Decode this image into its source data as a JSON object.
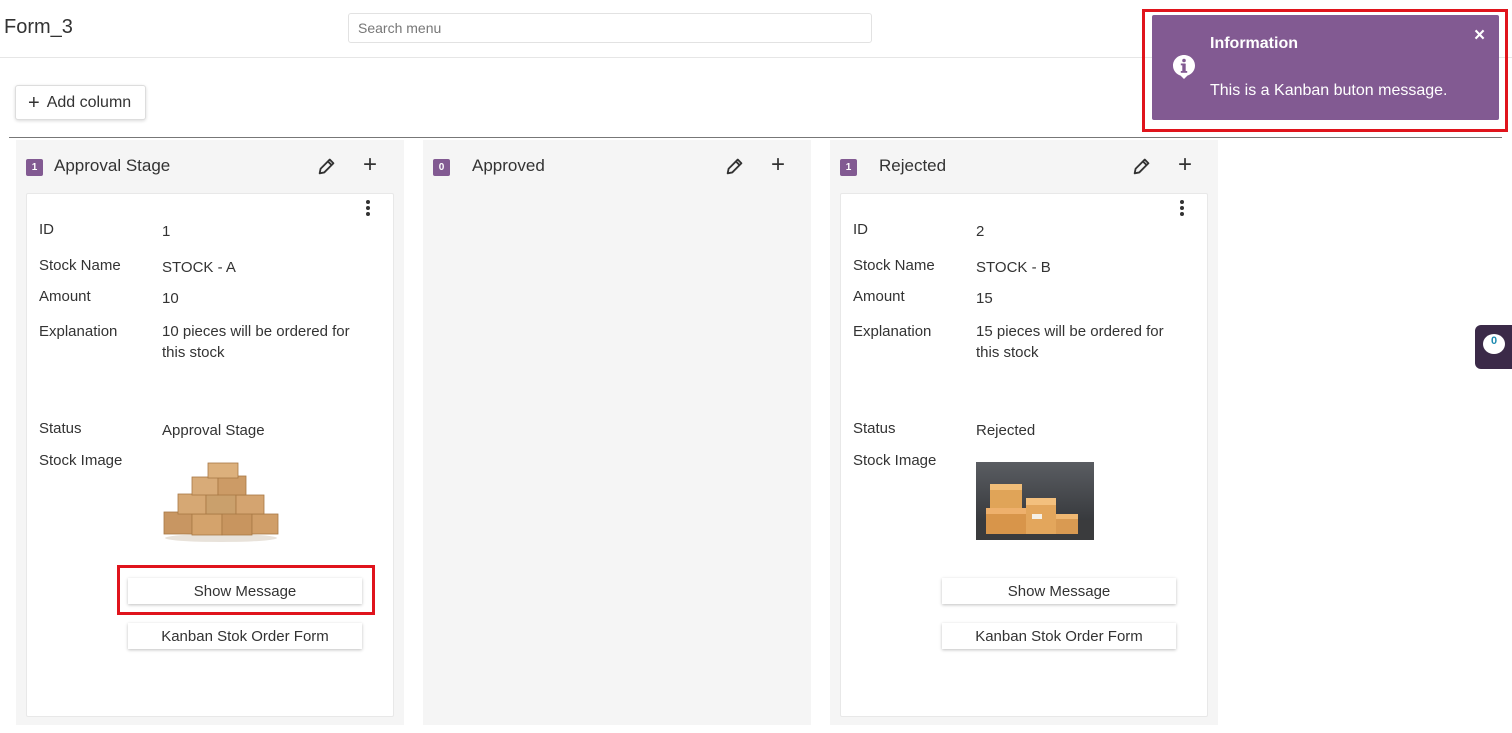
{
  "header": {
    "title": "Form_3",
    "search_placeholder": "Search menu"
  },
  "toolbar": {
    "add_column_label": "Add column"
  },
  "colors": {
    "accent": "#825a92",
    "highlight": "#e0141c"
  },
  "columns": [
    {
      "count": "1",
      "title": "Approval Stage",
      "cards": [
        {
          "fields": [
            {
              "label": "ID",
              "value": "1"
            },
            {
              "label": "Stock Name",
              "value": "STOCK - A"
            },
            {
              "label": "Amount",
              "value": "10"
            },
            {
              "label": "Explanation",
              "value": "10 pieces will be ordered for this stock"
            },
            {
              "label": "Status",
              "value": "Approval Stage"
            },
            {
              "label": "Stock Image",
              "value": ""
            }
          ],
          "buttons": [
            "Show Message",
            "Kanban Stok Order Form"
          ]
        }
      ]
    },
    {
      "count": "0",
      "title": "Approved",
      "cards": []
    },
    {
      "count": "1",
      "title": "Rejected",
      "cards": [
        {
          "fields": [
            {
              "label": "ID",
              "value": "2"
            },
            {
              "label": "Stock Name",
              "value": "STOCK - B"
            },
            {
              "label": "Amount",
              "value": "15"
            },
            {
              "label": "Explanation",
              "value": "15 pieces will be ordered for this stock"
            },
            {
              "label": "Status",
              "value": "Rejected"
            },
            {
              "label": "Stock Image",
              "value": ""
            }
          ],
          "buttons": [
            "Show Message",
            "Kanban Stok Order Form"
          ]
        }
      ]
    }
  ],
  "toast": {
    "title": "Information",
    "message": "This is a Kanban buton message.",
    "icon": "info-icon",
    "close_icon": "close-icon"
  },
  "chat": {
    "count": "0"
  }
}
